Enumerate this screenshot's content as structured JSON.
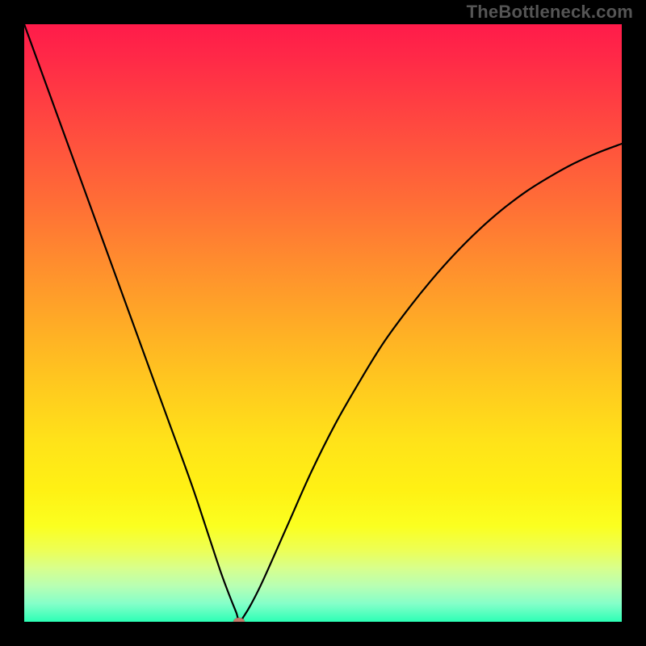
{
  "watermark": "TheBottleneck.com",
  "colors": {
    "frame": "#000000",
    "curve": "#000000",
    "min_dot": "#c47a6a",
    "gradient_top": "#ff1b4a",
    "gradient_bottom": "#2cffb5"
  },
  "chart_data": {
    "type": "line",
    "title": "",
    "xlabel": "",
    "ylabel": "",
    "xlim": [
      0,
      100
    ],
    "ylim": [
      0,
      100
    ],
    "grid": false,
    "legend": false,
    "annotations": [],
    "min_point": {
      "x": 36,
      "y": 0
    },
    "series": [
      {
        "name": "bottleneck-curve",
        "x": [
          0,
          4,
          8,
          12,
          16,
          20,
          24,
          28,
          31,
          33,
          34.5,
          35.5,
          36,
          36.8,
          38,
          40,
          44,
          48,
          52,
          56,
          60,
          64,
          68,
          72,
          76,
          80,
          84,
          88,
          92,
          96,
          100
        ],
        "y": [
          100,
          89,
          78,
          67,
          56,
          45,
          34,
          23,
          14,
          8,
          4,
          1.5,
          0,
          1,
          3,
          7,
          16,
          25,
          33,
          40,
          46.5,
          52,
          57,
          61.5,
          65.5,
          69,
          72,
          74.5,
          76.7,
          78.5,
          80
        ]
      }
    ]
  }
}
